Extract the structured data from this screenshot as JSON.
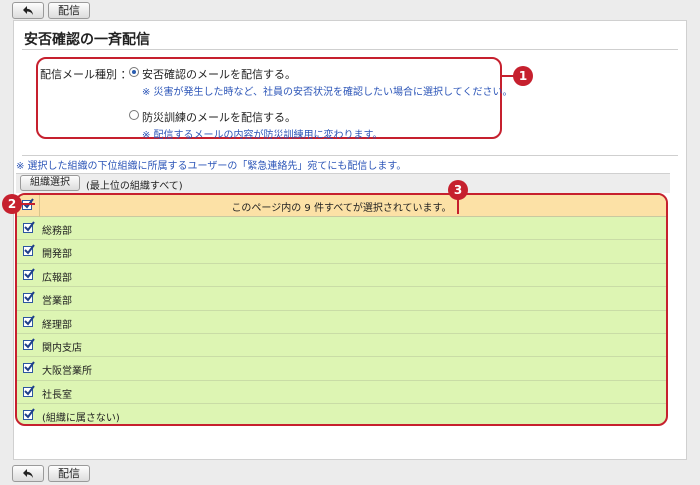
{
  "toolbar": {
    "back_label": "",
    "deliver_label": "配信"
  },
  "page": {
    "title": "安否確認の一斉配信"
  },
  "mail_type": {
    "label": "配信メール種別 ：",
    "options": [
      {
        "label": "安否確認のメールを配信する。",
        "note": "※ 災害が発生した時など、社員の安否状況を確認したい場合に選択してください。",
        "checked": true
      },
      {
        "label": "防災訓練のメールを配信する。",
        "note": "※ 配信するメールの内容が防災訓練用に変わります。",
        "checked": false
      }
    ]
  },
  "org_note": "※ 選択した組織の下位組織に所属するユーザーの「緊急連絡先」宛てにも配信します。",
  "org_select": {
    "button_label": "組織選択",
    "scope": "(最上位の組織すべて)"
  },
  "list": {
    "header": "このページ内の 9 件すべてが選択されています。",
    "items": [
      {
        "label": "総務部",
        "checked": true
      },
      {
        "label": "開発部",
        "checked": true
      },
      {
        "label": "広報部",
        "checked": true
      },
      {
        "label": "営業部",
        "checked": true
      },
      {
        "label": "経理部",
        "checked": true
      },
      {
        "label": "関内支店",
        "checked": true
      },
      {
        "label": "大阪営業所",
        "checked": true
      },
      {
        "label": "社長室",
        "checked": true
      },
      {
        "label": "(組織に属さない)",
        "checked": true
      }
    ]
  },
  "callouts": [
    "1",
    "2",
    "3"
  ],
  "colors": {
    "accent_red": "#c6202e",
    "note_blue": "#2d56b8",
    "header_bg": "#fce1a6",
    "row_bg": "#ddf5b3"
  }
}
